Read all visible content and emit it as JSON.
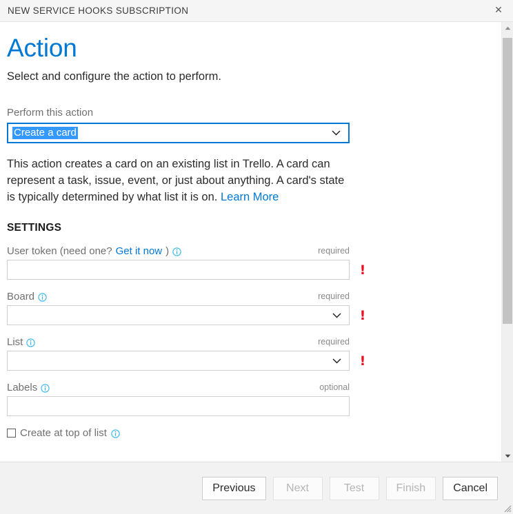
{
  "titlebar": {
    "title": "NEW SERVICE HOOKS SUBSCRIPTION",
    "close_icon": "close-icon",
    "close_glyph": "✕"
  },
  "header": {
    "title": "Action",
    "subtitle": "Select and configure the action to perform."
  },
  "action_select": {
    "label": "Perform this action",
    "value": "Create a card",
    "options": [
      "Create a card"
    ],
    "chevron_icon": "chevron-down-icon"
  },
  "description": {
    "text": "This action creates a card on an existing list in Trello. A card can represent a task, issue, event, or just about anything. A card's state is typically determined by what list it is on. ",
    "link_text": "Learn More"
  },
  "settings": {
    "heading": "SETTINGS",
    "fields": [
      {
        "label_prefix": "User token (need one? ",
        "link_text": "Get it now",
        "label_suffix": ")",
        "info_icon": "info-icon",
        "requirement": "required",
        "control": "text",
        "value": "",
        "placeholder": "",
        "error_marker": "!"
      },
      {
        "label_prefix": "Board",
        "link_text": "",
        "label_suffix": "",
        "info_icon": "info-icon",
        "requirement": "required",
        "control": "dropdown",
        "value": "",
        "placeholder": "",
        "error_marker": "!"
      },
      {
        "label_prefix": "List",
        "link_text": "",
        "label_suffix": "",
        "info_icon": "info-icon",
        "requirement": "required",
        "control": "dropdown",
        "value": "",
        "placeholder": "",
        "error_marker": "!"
      },
      {
        "label_prefix": "Labels",
        "link_text": "",
        "label_suffix": "",
        "info_icon": "info-icon",
        "requirement": "optional",
        "control": "text",
        "value": "",
        "placeholder": "",
        "error_marker": ""
      }
    ],
    "checkbox": {
      "label": "Create at top of list",
      "checked": false,
      "info_icon": "info-icon"
    }
  },
  "footer": {
    "buttons": [
      {
        "label": "Previous",
        "enabled": true
      },
      {
        "label": "Next",
        "enabled": false
      },
      {
        "label": "Test",
        "enabled": false
      },
      {
        "label": "Finish",
        "enabled": false
      },
      {
        "label": "Cancel",
        "enabled": true
      }
    ]
  },
  "scrollbar": {
    "up_icon": "scroll-up-arrow-icon",
    "down_icon": "scroll-down-arrow-icon",
    "thumb": "scrollbar-thumb"
  },
  "colors": {
    "accent": "#0078d4",
    "focus_border": "#0078d7",
    "selection": "#3399ff",
    "error": "#e81123",
    "info": "#35b5f0"
  }
}
